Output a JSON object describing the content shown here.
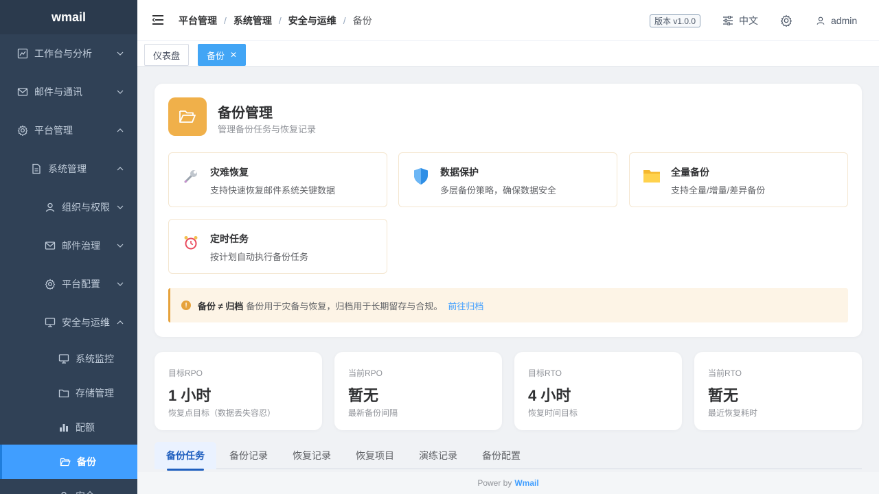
{
  "app": {
    "logo": "wmail"
  },
  "sidebar": {
    "workbench": "工作台与分析",
    "mail": "邮件与通讯",
    "platform": "平台管理",
    "system": "系统管理",
    "org": "组织与权限",
    "governance": "邮件治理",
    "platform_config": "平台配置",
    "security_ops": "安全与运维",
    "monitor": "系统监控",
    "storage": "存储管理",
    "quota": "配额",
    "backup": "备份",
    "partial": "安全"
  },
  "header": {
    "breadcrumb": [
      "平台管理",
      "系统管理",
      "安全与运维",
      "备份"
    ],
    "version": "版本 v1.0.0",
    "language": "中文",
    "user": "admin"
  },
  "tags": {
    "dashboard": "仪表盘",
    "backup": "备份",
    "close": "✕"
  },
  "page": {
    "title": "备份管理",
    "subtitle": "管理备份任务与恢复记录"
  },
  "features": [
    {
      "title": "灾难恢复",
      "desc": "支持快速恢复邮件系统关键数据",
      "icon": "wrench-icon"
    },
    {
      "title": "数据保护",
      "desc": "多层备份策略，确保数据安全",
      "icon": "shield-icon"
    },
    {
      "title": "全量备份",
      "desc": "支持全量/增量/差异备份",
      "icon": "folder-icon"
    },
    {
      "title": "定时任务",
      "desc": "按计划自动执行备份任务",
      "icon": "alarm-clock-icon"
    }
  ],
  "notice": {
    "strong": "备份 ≠ 归档",
    "text": "备份用于灾备与恢复，归档用于长期留存与合规。",
    "link": "前往归档"
  },
  "stats": [
    {
      "label": "目标RPO",
      "value": "1 小时",
      "desc": "恢复点目标（数据丢失容忍）"
    },
    {
      "label": "当前RPO",
      "value": "暂无",
      "desc": "最新备份间隔"
    },
    {
      "label": "目标RTO",
      "value": "4 小时",
      "desc": "恢复时间目标"
    },
    {
      "label": "当前RTO",
      "value": "暂无",
      "desc": "最近恢复耗时"
    }
  ],
  "tabs": [
    "备份任务",
    "备份记录",
    "恢复记录",
    "恢复项目",
    "演练记录",
    "备份配置"
  ],
  "footer": {
    "prefix": "Power by",
    "brand": "Wmail"
  },
  "colors": {
    "sidebar": "#304156",
    "accent": "#409eff",
    "warning": "#e6a23c"
  }
}
